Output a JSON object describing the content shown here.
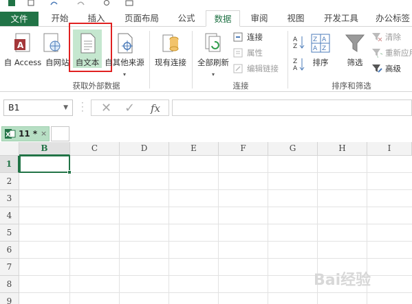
{
  "ribbon_tabs": [
    "文件",
    "开始",
    "插入",
    "页面布局",
    "公式",
    "数据",
    "审阅",
    "视图",
    "开发工具",
    "办公标签"
  ],
  "active_tab": "数据",
  "accent": "#217346",
  "get_external": {
    "from_access": "自 Access",
    "from_web": "自网站",
    "from_text": "自文本",
    "from_other": "自其他来源",
    "existing": "现有连接",
    "group_label": "获取外部数据"
  },
  "connections": {
    "refresh_all": "全部刷新",
    "connections": "连接",
    "properties": "属性",
    "edit_links": "编辑链接",
    "group_label": "连接"
  },
  "sort_filter": {
    "sort": "排序",
    "filter": "筛选",
    "clear": "清除",
    "reapply": "重新应用",
    "advanced": "高级",
    "group_label": "排序和筛选"
  },
  "formula_bar": {
    "name_box": "B1",
    "fx": "fx",
    "value": ""
  },
  "workbook_tab": {
    "name": "11 *",
    "close": "×"
  },
  "columns": [
    "B",
    "C",
    "D",
    "E",
    "F",
    "G",
    "H",
    "I"
  ],
  "selected_column": "B",
  "rows": [
    "1",
    "2",
    "3",
    "4",
    "5",
    "6",
    "7",
    "8",
    "9"
  ],
  "selected_row": "1",
  "selected_cell": "B1",
  "watermark": "Bai经验"
}
